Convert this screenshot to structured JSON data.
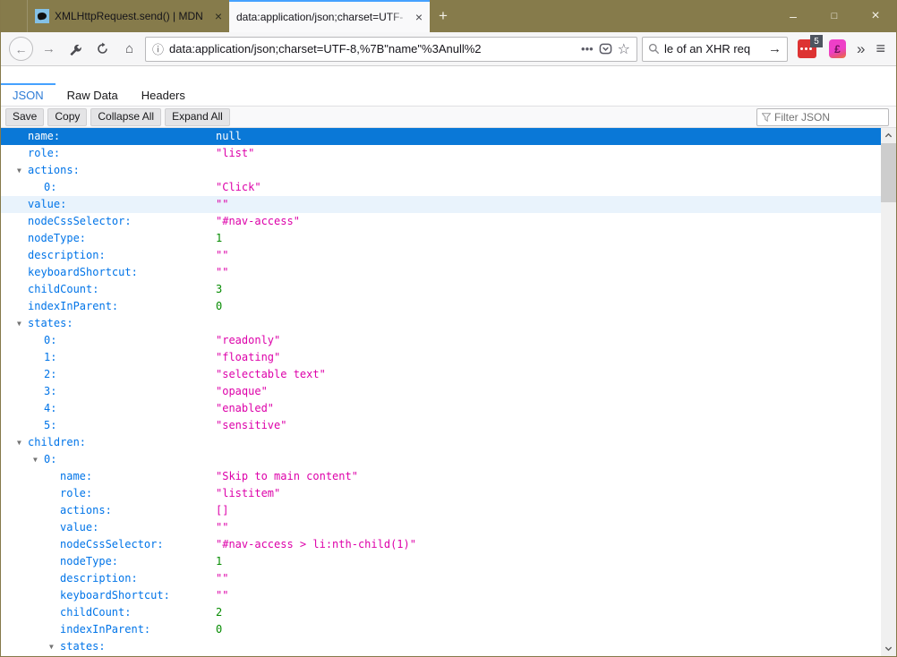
{
  "titlebar": {
    "tabs": [
      {
        "title": "XMLHttpRequest.send() | MDN",
        "close_glyph": "×",
        "active": false
      },
      {
        "title": "data:application/json;charset=UTF-",
        "close_glyph": "×",
        "active": true
      }
    ],
    "new_tab_glyph": "+",
    "controls": {
      "minimize": "–",
      "maximize": "□",
      "close": "×"
    }
  },
  "navbar": {
    "back_glyph": "←",
    "forward_glyph": "→",
    "reload_name": "reload",
    "home_glyph": "⌂",
    "url": {
      "info_glyph": "ⓘ",
      "text": "data:application/json;charset=UTF-8,%7B\"name\"%3Anull%2",
      "page_actions_glyph": "•••",
      "bookmark_star_glyph": "☆"
    },
    "search": {
      "text": "le of an XHR req",
      "go_glyph": "→"
    },
    "extensions": {
      "badge_count": "5",
      "ext2_glyph": "£"
    },
    "overflow_glyph": "»",
    "menu_glyph": "≡"
  },
  "viewer": {
    "tabs": [
      {
        "label": "JSON",
        "active": true
      },
      {
        "label": "Raw Data",
        "active": false
      },
      {
        "label": "Headers",
        "active": false
      }
    ],
    "buttons": {
      "save": "Save",
      "copy": "Copy",
      "collapse_all": "Collapse All",
      "expand_all": "Expand All"
    },
    "filter_placeholder": "Filter JSON"
  },
  "json_tree": {
    "arrow_glyph": "▼",
    "rows": [
      {
        "key": "name:",
        "value": "null",
        "type": "null",
        "level": 0,
        "expandable": false,
        "state": "selected"
      },
      {
        "key": "role:",
        "value": "\"list\"",
        "type": "string",
        "level": 0,
        "expandable": false,
        "state": null
      },
      {
        "key": "actions:",
        "value": null,
        "type": null,
        "level": 0,
        "expandable": true,
        "state": null
      },
      {
        "key": "0:",
        "value": "\"Click\"",
        "type": "string",
        "level": 1,
        "expandable": false,
        "state": null
      },
      {
        "key": "value:",
        "value": "\"\"",
        "type": "string",
        "level": 0,
        "expandable": false,
        "state": "hover"
      },
      {
        "key": "nodeCssSelector:",
        "value": "\"#nav-access\"",
        "type": "string",
        "level": 0,
        "expandable": false,
        "state": null
      },
      {
        "key": "nodeType:",
        "value": "1",
        "type": "number",
        "level": 0,
        "expandable": false,
        "state": null
      },
      {
        "key": "description:",
        "value": "\"\"",
        "type": "string",
        "level": 0,
        "expandable": false,
        "state": null
      },
      {
        "key": "keyboardShortcut:",
        "value": "\"\"",
        "type": "string",
        "level": 0,
        "expandable": false,
        "state": null
      },
      {
        "key": "childCount:",
        "value": "3",
        "type": "number",
        "level": 0,
        "expandable": false,
        "state": null
      },
      {
        "key": "indexInParent:",
        "value": "0",
        "type": "number",
        "level": 0,
        "expandable": false,
        "state": null
      },
      {
        "key": "states:",
        "value": null,
        "type": null,
        "level": 0,
        "expandable": true,
        "state": null
      },
      {
        "key": "0:",
        "value": "\"readonly\"",
        "type": "string",
        "level": 1,
        "expandable": false,
        "state": null
      },
      {
        "key": "1:",
        "value": "\"floating\"",
        "type": "string",
        "level": 1,
        "expandable": false,
        "state": null
      },
      {
        "key": "2:",
        "value": "\"selectable text\"",
        "type": "string",
        "level": 1,
        "expandable": false,
        "state": null
      },
      {
        "key": "3:",
        "value": "\"opaque\"",
        "type": "string",
        "level": 1,
        "expandable": false,
        "state": null
      },
      {
        "key": "4:",
        "value": "\"enabled\"",
        "type": "string",
        "level": 1,
        "expandable": false,
        "state": null
      },
      {
        "key": "5:",
        "value": "\"sensitive\"",
        "type": "string",
        "level": 1,
        "expandable": false,
        "state": null
      },
      {
        "key": "children:",
        "value": null,
        "type": null,
        "level": 0,
        "expandable": true,
        "state": null
      },
      {
        "key": "0:",
        "value": null,
        "type": null,
        "level": 1,
        "expandable": true,
        "state": null
      },
      {
        "key": "name:",
        "value": "\"Skip to main content\"",
        "type": "string",
        "level": 2,
        "expandable": false,
        "state": null
      },
      {
        "key": "role:",
        "value": "\"listitem\"",
        "type": "string",
        "level": 2,
        "expandable": false,
        "state": null
      },
      {
        "key": "actions:",
        "value": "[]",
        "type": "array",
        "level": 2,
        "expandable": false,
        "state": null
      },
      {
        "key": "value:",
        "value": "\"\"",
        "type": "string",
        "level": 2,
        "expandable": false,
        "state": null
      },
      {
        "key": "nodeCssSelector:",
        "value": "\"#nav-access > li:nth-child(1)\"",
        "type": "string",
        "level": 2,
        "expandable": false,
        "state": null
      },
      {
        "key": "nodeType:",
        "value": "1",
        "type": "number",
        "level": 2,
        "expandable": false,
        "state": null
      },
      {
        "key": "description:",
        "value": "\"\"",
        "type": "string",
        "level": 2,
        "expandable": false,
        "state": null
      },
      {
        "key": "keyboardShortcut:",
        "value": "\"\"",
        "type": "string",
        "level": 2,
        "expandable": false,
        "state": null
      },
      {
        "key": "childCount:",
        "value": "2",
        "type": "number",
        "level": 2,
        "expandable": false,
        "state": null
      },
      {
        "key": "indexInParent:",
        "value": "0",
        "type": "number",
        "level": 2,
        "expandable": false,
        "state": null
      },
      {
        "key": "states:",
        "value": null,
        "type": null,
        "level": 2,
        "expandable": true,
        "state": null
      }
    ]
  },
  "colors": {
    "titlebar_olive": "#867b4b",
    "active_tab_stripe": "#45a1ff",
    "selection_blue": "#0a78d7",
    "hover_row": "#e9f3fc",
    "json_key": "#0074e8",
    "json_string": "#dd00a9",
    "json_number": "#058b00",
    "viewer_tab_active": "#2e7cd6"
  }
}
